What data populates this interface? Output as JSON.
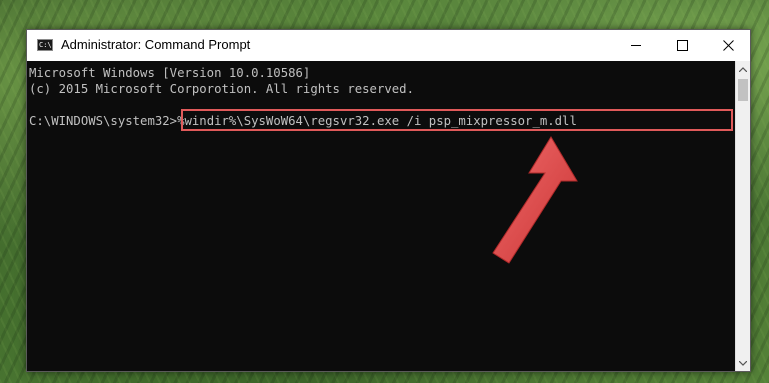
{
  "window": {
    "title": "Administrator: Command Prompt",
    "icon_label": "C:\\"
  },
  "console": {
    "lines": [
      "Microsoft Windows [Version 10.0.10586]",
      "(c) 2015 Microsoft Corporotion. All rights reserved."
    ],
    "prompt": "C:\\WINDOWS\\system32>",
    "command": "%windir%\\SysWoW64\\regsvr32.exe /i psp_mixpressor_m.dll"
  },
  "colors": {
    "highlight": "#e05a5a",
    "console_bg": "#0c0c0c",
    "console_text": "#c0c0c0"
  },
  "icons": {
    "title": "cmd-icon",
    "minimize": "minimize-icon",
    "maximize": "maximize-icon",
    "close": "close-icon",
    "annotation": "red-arrow-icon"
  }
}
